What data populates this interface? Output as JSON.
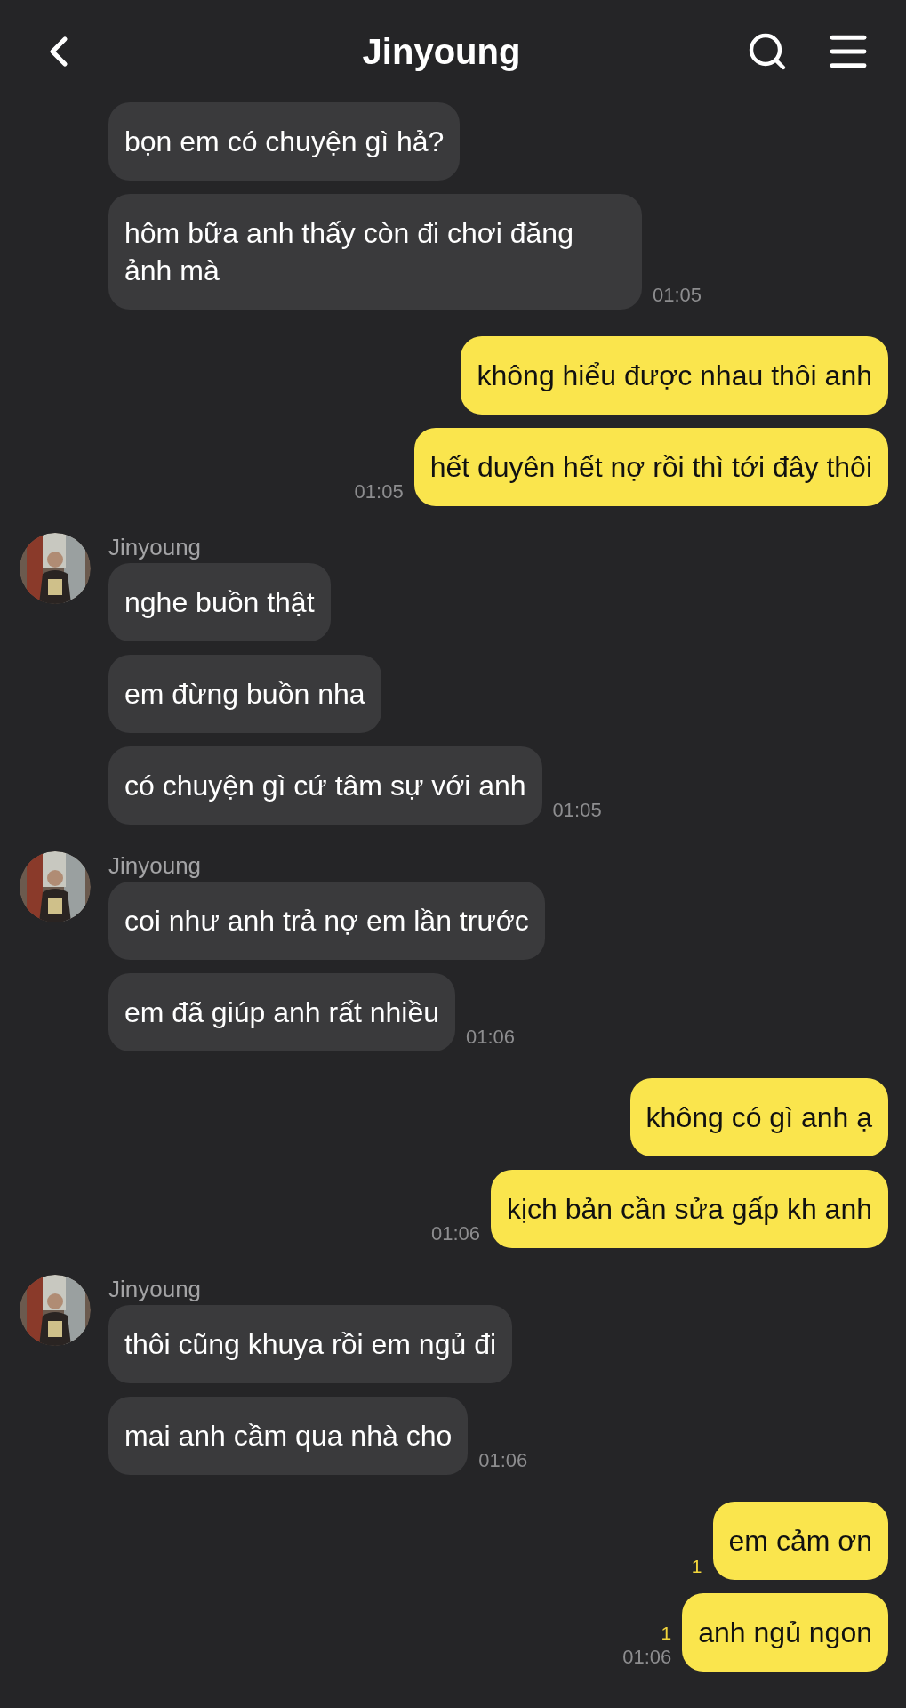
{
  "header": {
    "title": "Jinyoung"
  },
  "groups": [
    {
      "kind": "incoming",
      "messages": [
        {
          "text": "bọn em có chuyện gì hả?"
        },
        {
          "text": "hôm bữa anh thấy còn đi chơi đăng ảnh mà",
          "time": "01:05"
        }
      ]
    },
    {
      "kind": "outgoing",
      "messages": [
        {
          "text": "không hiểu được nhau thôi anh"
        },
        {
          "text": "hết duyên hết nợ rồi thì tới đây thôi",
          "time": "01:05"
        }
      ]
    },
    {
      "kind": "incoming",
      "sender": "Jinyoung",
      "messages": [
        {
          "text": "nghe buồn thật"
        },
        {
          "text": "em đừng buồn nha"
        },
        {
          "text": "có chuyện gì cứ tâm sự với anh",
          "time": "01:05"
        }
      ]
    },
    {
      "kind": "incoming",
      "sender": "Jinyoung",
      "messages": [
        {
          "text": "coi như anh trả nợ em lần trước"
        },
        {
          "text": "em đã giúp anh rất nhiều",
          "time": "01:06"
        }
      ]
    },
    {
      "kind": "outgoing",
      "messages": [
        {
          "text": "không có gì anh ạ"
        },
        {
          "text": "kịch bản cần sửa gấp kh anh",
          "time": "01:06"
        }
      ]
    },
    {
      "kind": "incoming",
      "sender": "Jinyoung",
      "messages": [
        {
          "text": "thôi cũng khuya rồi em ngủ đi"
        },
        {
          "text": "mai anh cầm qua nhà cho",
          "time": "01:06"
        }
      ]
    },
    {
      "kind": "outgoing",
      "messages": [
        {
          "text": "em cảm ơn",
          "unread": "1"
        },
        {
          "text": "anh ngủ ngon",
          "unread": "1",
          "time": "01:06"
        }
      ]
    }
  ]
}
